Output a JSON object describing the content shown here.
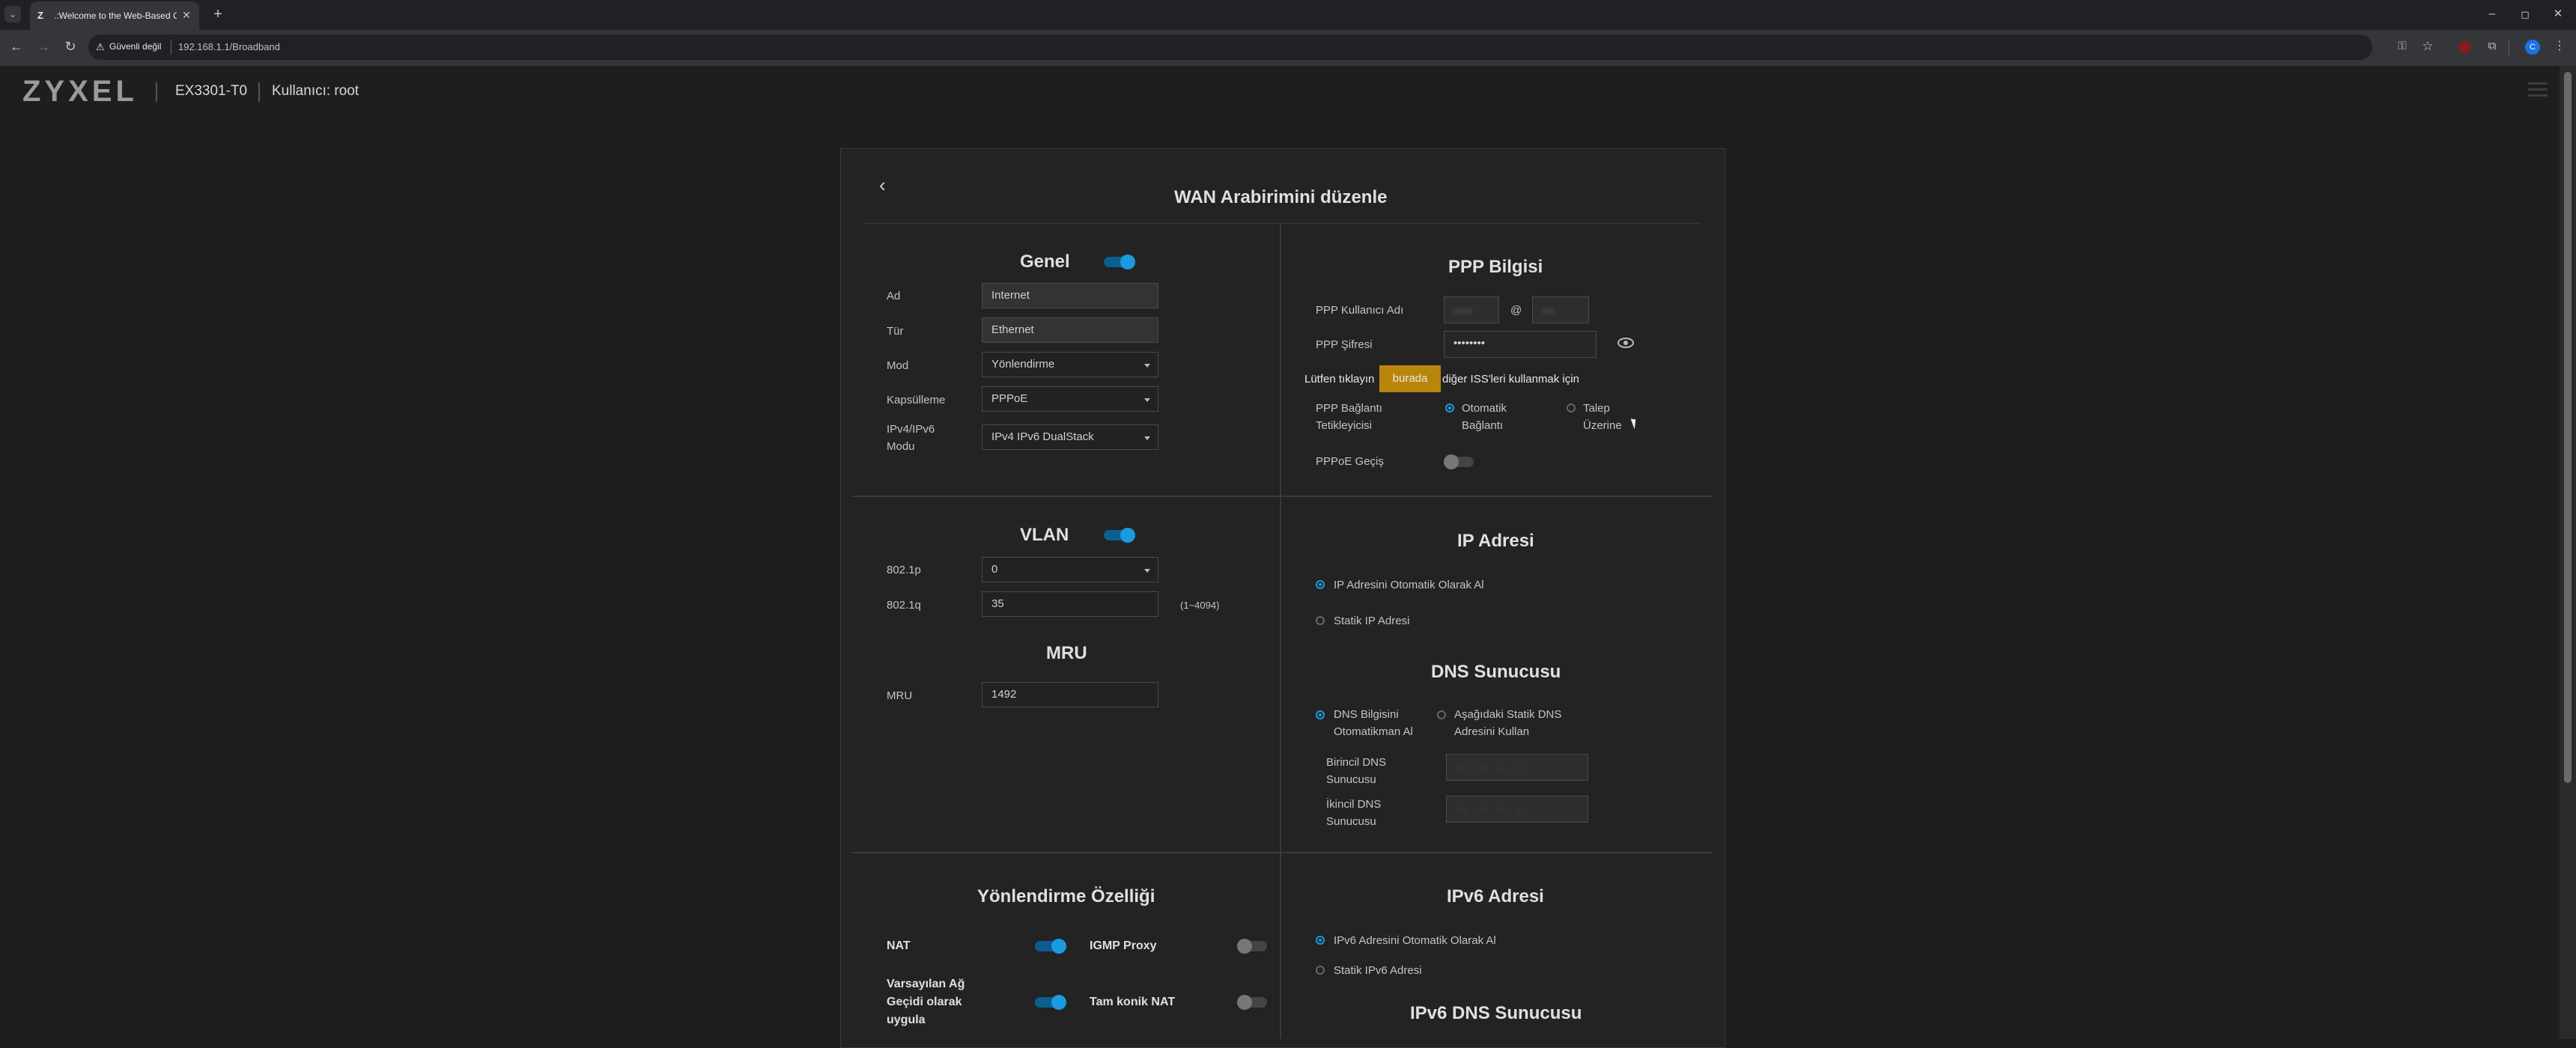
{
  "browser": {
    "tab_title": ".:Welcome to the Web-Based C",
    "security_label": "Güvenli değil",
    "url": "192.168.1.1/Broadband",
    "new_tab": "+",
    "minimize": "–",
    "maximize": "◻",
    "close": "✕",
    "profile_initial": "C"
  },
  "header": {
    "logo": "ZYXEL",
    "model": "EX3301-T0",
    "user": "Kullanıcı: root"
  },
  "dialog": {
    "title": "WAN Arabirimini düzenle",
    "genel": {
      "title": "Genel",
      "enabled": true,
      "ad_label": "Ad",
      "ad_value": "Internet",
      "tur_label": "Tür",
      "tur_value": "Ethernet",
      "mod_label": "Mod",
      "mod_value": "Yönlendirme",
      "kapsulleme_label": "Kapsülleme",
      "kapsulleme_value": "PPPoE",
      "ipmode_label_1": "IPv4/IPv6",
      "ipmode_label_2": "Modu",
      "ipmode_value": "IPv4 IPv6 DualStack"
    },
    "ppp": {
      "title": "PPP Bilgisi",
      "username_label": "PPP Kullanıcı Adı",
      "at": "@",
      "password_label": "PPP Şifresi",
      "password_value": "••••••••",
      "hint_before": "Lütfen tıklayın",
      "hint_link": "burada",
      "hint_after": "diğer ISS'leri kullanmak için",
      "trigger_label_1": "PPP Bağlantı",
      "trigger_label_2": "Tetikleyicisi",
      "trigger_opt1_1": "Otomatik",
      "trigger_opt1_2": "Bağlantı",
      "trigger_opt2_1": "Talep",
      "trigger_opt2_2": "Üzerine",
      "passthrough_label": "PPPoE Geçiş",
      "passthrough_on": false
    },
    "vlan": {
      "title": "VLAN",
      "enabled": true,
      "p_label": "802.1p",
      "p_value": "0",
      "q_label": "802.1q",
      "q_value": "35",
      "q_range": "(1~4094)"
    },
    "mru": {
      "title": "MRU",
      "label": "MRU",
      "value": "1492"
    },
    "ip": {
      "title": "IP Adresi",
      "opt_auto": "IP Adresini Otomatik Olarak Al",
      "opt_static": "Statik IP Adresi",
      "selected": "auto"
    },
    "dns": {
      "title": "DNS Sunucusu",
      "opt_auto_1": "DNS Bilgisini",
      "opt_auto_2": "Otomatikman Al",
      "opt_static_1": "Aşağıdaki Statik DNS",
      "opt_static_2": "Adresini Kullan",
      "primary_label_1": "Birincil DNS",
      "primary_label_2": "Sunucusu",
      "secondary_label_1": "İkincil DNS",
      "secondary_label_2": "Sunucusu"
    },
    "routing": {
      "title": "Yönlendirme Özelliği",
      "nat_label": "NAT",
      "nat_on": true,
      "igmp_label": "IGMP Proxy",
      "igmp_on": false,
      "default_gw_1": "Varsayılan Ağ",
      "default_gw_2": "Geçidi olarak",
      "default_gw_3": "uygula",
      "default_gw_on": true,
      "full_cone_label": "Tam konik NAT",
      "full_cone_on": false
    },
    "ipv6": {
      "title": "IPv6 Adresi",
      "opt_auto": "IPv6 Adresini Otomatik Olarak Al",
      "opt_static": "Statik IPv6 Adresi",
      "dns_title": "IPv6 DNS Sunucusu"
    }
  },
  "colors": {
    "accent": "#1b9ae0",
    "link_bg": "#b8860b",
    "background": "#1e1e1e",
    "card": "#232323"
  },
  "icons": [
    "back-arrow-icon",
    "chevron-left-icon",
    "eye-icon",
    "menu-icon",
    "reload-icon",
    "star-icon",
    "key-icon",
    "extensions-icon",
    "lock-warning-icon",
    "mouse-cursor-icon"
  ]
}
